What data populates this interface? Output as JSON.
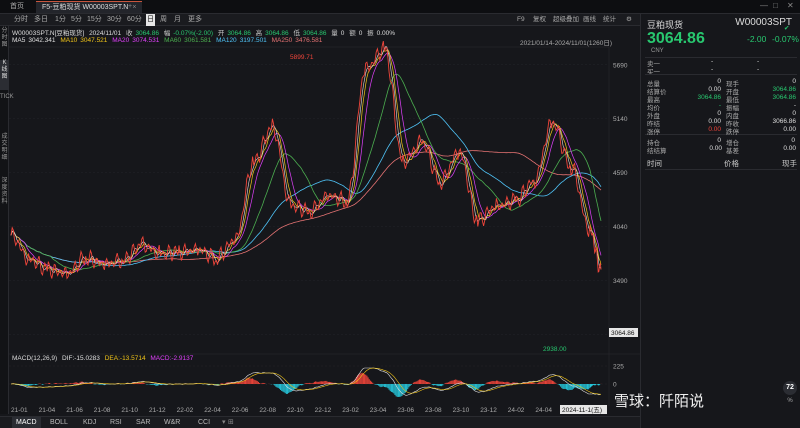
{
  "titlebar": {
    "home_label": "首页",
    "tab_label": "F5-豆粕现货 W00003SPT.N",
    "close_glyph": "×",
    "plus_glyph": "+"
  },
  "toolbar": {
    "periods": [
      "分时",
      "多日",
      "1分",
      "5分",
      "15分",
      "30分",
      "60分",
      "日",
      "周",
      "月",
      "更多"
    ],
    "active_period": "日",
    "tools": [
      "F9",
      "复权",
      "超级叠加",
      "画线",
      "统计"
    ]
  },
  "info": {
    "line1": {
      "name": "W00003SPT.N[豆粕现货]",
      "date": "2024/11/01",
      "close_label": "收",
      "close": "3064.86",
      "change_label": "幅",
      "change": "-0.07%(-2.00)",
      "open_label": "开",
      "open": "3064.86",
      "high_label": "高",
      "high": "3064.86",
      "low_label": "低",
      "low": "3064.86",
      "volume_label": "量",
      "volume": "0",
      "turnover_label": "额",
      "turnover": "0",
      "swing_label": "振",
      "swing": "0.00%"
    },
    "ma": [
      {
        "label": "MA5",
        "value": "3042.341",
        "color": "#e0e0e0"
      },
      {
        "label": "MA10",
        "value": "3047.521",
        "color": "#f0c419"
      },
      {
        "label": "MA20",
        "value": "3074.531",
        "color": "#e040fb"
      },
      {
        "label": "MA60",
        "value": "3061.581",
        "color": "#4caf50"
      },
      {
        "label": "MA120",
        "value": "3197.501",
        "color": "#4fc3f7"
      },
      {
        "label": "MA250",
        "value": "3476.581",
        "color": "#e57373"
      }
    ],
    "range": "2021/01/14-2024/11/01(1260日)"
  },
  "chart_data": {
    "type": "line",
    "title": "",
    "ylim": [
      2800,
      5800
    ],
    "y_ticks": [
      "5690",
      "5140",
      "4590",
      "4040",
      "3490",
      "2940"
    ],
    "y_tick_values": [
      5690,
      5140,
      4590,
      4040,
      3490,
      2940
    ],
    "x_ticks": [
      "21-01",
      "21-04",
      "21-06",
      "21-08",
      "21-10",
      "21-12",
      "22-02",
      "22-04",
      "22-06",
      "22-08",
      "22-10",
      "22-12",
      "23-02",
      "23-04",
      "23-06",
      "23-08",
      "23-10",
      "23-12",
      "24-02",
      "24-04"
    ],
    "last_date_label": "2024-11-1(五)",
    "max_label": "5899.71",
    "min_label": "2938.00",
    "last_price_label": "3064.86",
    "series_x_quarters": [
      0,
      0.5,
      1,
      1.5,
      2,
      2.5,
      3,
      3.5,
      4,
      4.5,
      5,
      5.5,
      6,
      6.5,
      7,
      7.5,
      8,
      8.5,
      9,
      9.5,
      10,
      10.5,
      11,
      11.5,
      12,
      12.5,
      13,
      13.5,
      14,
      14.5,
      15,
      15.5,
      15.8
    ],
    "price": [
      3950,
      3700,
      3600,
      3560,
      3720,
      3650,
      3700,
      3850,
      3760,
      3780,
      3800,
      3720,
      3900,
      4700,
      5050,
      4250,
      4200,
      4350,
      4300,
      5650,
      5850,
      4700,
      4900,
      4500,
      4800,
      4100,
      4250,
      4300,
      4500,
      5100,
      4650,
      4000,
      3600
    ],
    "macd": {
      "label": "MACD(12,26,9)",
      "dif_label": "DIF:",
      "dif": "-15.0283",
      "dea_label": "DEA:",
      "dea": "-13.5714",
      "macd_label": "MACD:",
      "macd_value": "-2.9137",
      "y_ticks": [
        "225",
        "0"
      ]
    }
  },
  "panel": {
    "name": "豆粕现货",
    "code": "W00003SPT",
    "price": "3064.86",
    "change": "-2.00",
    "change_pct": "-0.07%",
    "currency": "CNY",
    "sell_label": "卖一",
    "sell_value": "-",
    "sell_vol": "-",
    "buy_label": "买一",
    "buy_value": "-",
    "buy_vol": "-",
    "left_rows": [
      {
        "label": "总量",
        "value": "0"
      },
      {
        "label": "结算价",
        "value": "0.00"
      },
      {
        "label": "最高",
        "value": "3064.86"
      },
      {
        "label": "均价",
        "value": "-"
      },
      {
        "label": "外盘",
        "value": "0"
      },
      {
        "label": "昨结",
        "value": "0.00"
      },
      {
        "label": "涨停",
        "value": "0.00"
      }
    ],
    "right_rows": [
      {
        "label": "现手",
        "value": "0"
      },
      {
        "label": "开盘",
        "value": "3064.86"
      },
      {
        "label": "最低",
        "value": "3064.86"
      },
      {
        "label": "振幅",
        "value": "-"
      },
      {
        "label": "内盘",
        "value": "0"
      },
      {
        "label": "昨收",
        "value": "3066.86"
      },
      {
        "label": "跌停",
        "value": "0.00"
      }
    ],
    "left_rows2": [
      {
        "label": "持仓",
        "value": "0"
      },
      {
        "label": "结结算",
        "value": "0.00"
      }
    ],
    "right_rows2": [
      {
        "label": "增仓",
        "value": "0"
      },
      {
        "label": "基差",
        "value": "0.00"
      }
    ],
    "trades_headers": [
      "时间",
      "价格",
      "现手"
    ]
  },
  "indicators": [
    "MACD",
    "BOLL",
    "KDJ",
    "RSI",
    "SAR",
    "W&R",
    "CCI"
  ],
  "vertical_tabs": [
    "分时图",
    "K线图",
    "TICK",
    "成交明细",
    "深度资料"
  ],
  "watermark": "雪球：阡陌说",
  "side_badge": "72",
  "side_badge_unit": "%",
  "colors": {
    "up": "#f0453a",
    "down": "#28c76f",
    "price_line": "#f0c419"
  }
}
